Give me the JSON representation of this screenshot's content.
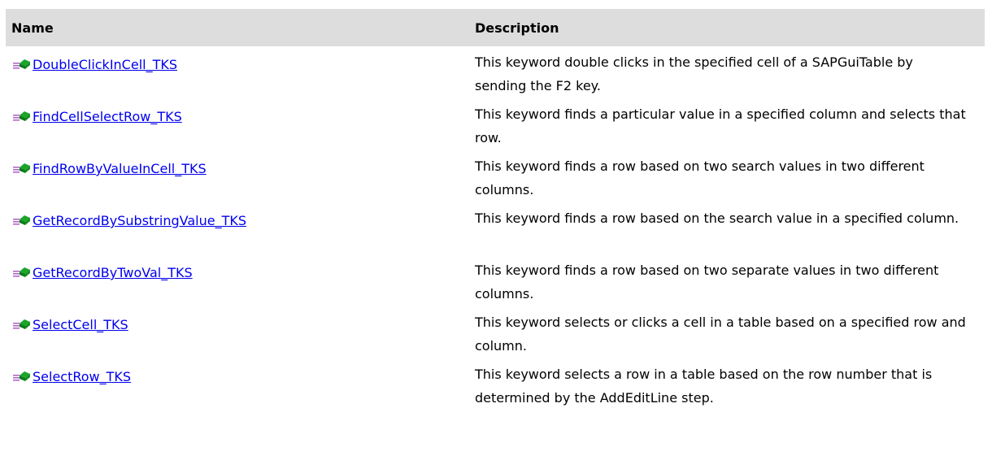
{
  "header": {
    "name_label": "Name",
    "description_label": "Description"
  },
  "icon": "public-method-icon",
  "colors": {
    "header_bg": "#dddddd",
    "link": "#0000ee",
    "icon_green": "#1aa52c",
    "icon_lines": "#b068c8"
  },
  "rows": [
    {
      "name": "DoubleClickInCell_TKS",
      "description": "This keyword double clicks in the specified cell of a SAPGuiTable by sending the F2 key."
    },
    {
      "name": "FindCellSelectRow_TKS",
      "description": "This keyword finds a particular value in a specified column and selects that row."
    },
    {
      "name": "FindRowByValueInCell_TKS",
      "description": "This keyword finds a row based on two search values in two different columns."
    },
    {
      "name": "GetRecordBySubstringValue_TKS",
      "description": "This keyword finds a row based on the search value in a specified column."
    },
    {
      "name": "GetRecordByTwoVal_TKS",
      "description": "This keyword finds a row based on two separate values in two different columns."
    },
    {
      "name": "SelectCell_TKS",
      "description": "This keyword selects or clicks a cell in a table based on a specified row and column."
    },
    {
      "name": "SelectRow_TKS",
      "description": "This keyword selects a row in a table based on the row number that is determined by the AddEditLine step."
    }
  ]
}
